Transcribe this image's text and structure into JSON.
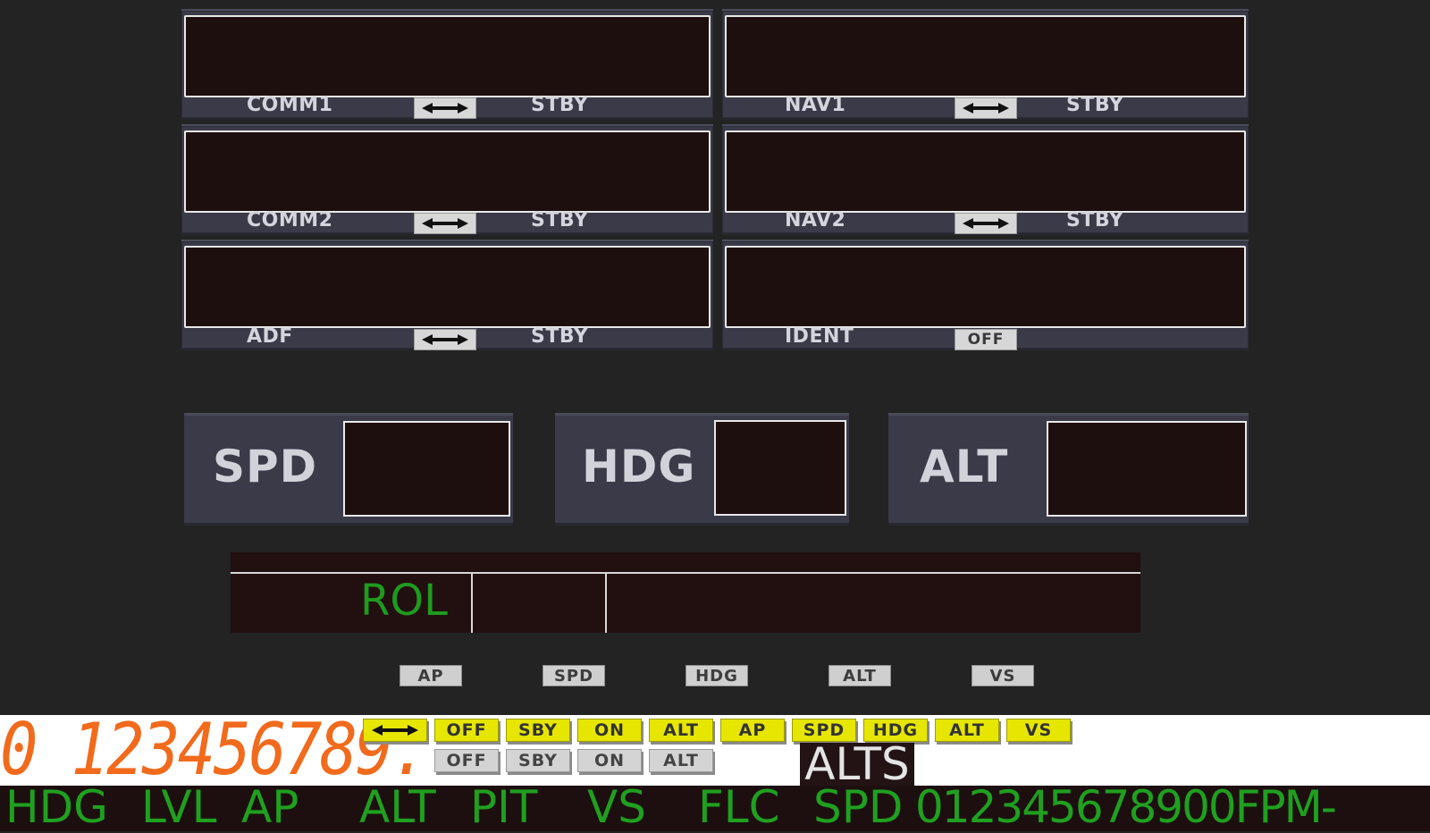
{
  "radio": {
    "comm1_label": "COMM1",
    "comm2_label": "COMM2",
    "adf_label": "ADF",
    "nav1_label": "NAV1",
    "nav2_label": "NAV2",
    "ident_label": "IDENT",
    "stby_label": "STBY",
    "ident_state": "OFF"
  },
  "autopilot_boxes": {
    "spd": "SPD",
    "hdg": "HDG",
    "alt": "ALT"
  },
  "annunciator": {
    "rol": "ROL"
  },
  "mode_buttons": [
    "AP",
    "SPD",
    "HDG",
    "ALT",
    "VS"
  ],
  "sprites": {
    "digits": "0 123456789.",
    "yellow_buttons": [
      "OFF",
      "SBY",
      "ON",
      "ALT",
      "AP",
      "SPD",
      "HDG",
      "ALT",
      "VS"
    ],
    "gray_buttons": [
      "OFF",
      "SBY",
      "ON",
      "ALT"
    ],
    "alts": "ALTS",
    "green_row": [
      "HDG",
      "LVL",
      "AP",
      "ALT",
      "PIT",
      "VS",
      "FLC",
      "SPD",
      "012345678900FPM-"
    ]
  },
  "colors": {
    "display_bg": "#1e0f0f",
    "panel": "#3a3a48",
    "annunciator_green": "#1fa01f",
    "digit_orange": "#f26a1c",
    "active_yellow": "#e6e600"
  }
}
